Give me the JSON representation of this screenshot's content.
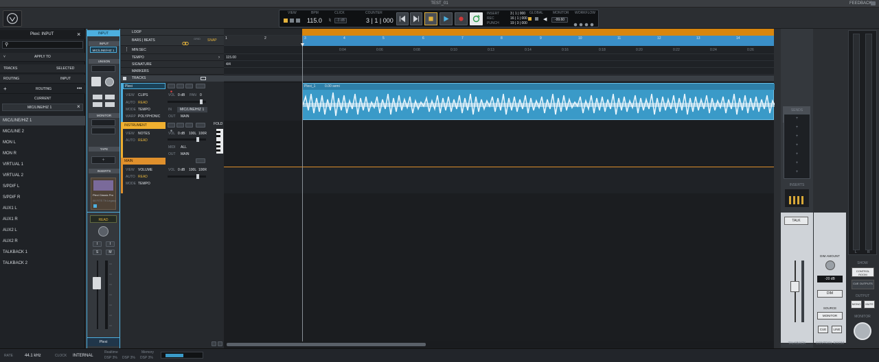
{
  "window": {
    "title": "TEST_01",
    "feedback": "FEEDBACK"
  },
  "transport": {
    "view_label": "VIEW",
    "bpm_label": "BPM",
    "bpm": "115.0",
    "click_label": "CLICK",
    "click_level": "-3 dB",
    "counter_label": "COUNTER",
    "counter": "3 | 1 | 000",
    "insert_label": "INSERT",
    "punch_labels": [
      "REC",
      "PUNCH"
    ],
    "bars_display": [
      "3 | 1 | 000",
      "16 | 1 | 000",
      "19 | 3 | 000"
    ],
    "global_label": "GLOBAL",
    "monitor_label": "MONITOR",
    "monitor_value": "-99.60",
    "workflow_label": "WORKFLOW"
  },
  "input_panel": {
    "title": "Plexi: INPUT",
    "apply_to": "APPLY TO",
    "tracks_label": "TRACKS",
    "tracks_value": "SELECTED",
    "routing_label": "ROUTING",
    "routing_value": "INPUT",
    "routing_header": "ROUTING",
    "current_label": "CURRENT",
    "current_value": "MIC/LINE/HIZ 1",
    "inputs": [
      "MIC/LINE/HIZ 1",
      "MIC/LINE 2",
      "MON L",
      "MON R",
      "VIRTUAL 1",
      "VIRTUAL 2",
      "S/PDIF L",
      "S/PDIF R",
      "AUX1 L",
      "AUX1 R",
      "AUX2 L",
      "AUX2 R",
      "TALKBACK 1",
      "TALKBACK 2"
    ]
  },
  "strip": {
    "input_header": "INPUT",
    "input_label": "INPUT",
    "input_value": "MIC/LINE/HIZ 1",
    "unison_label": "UNISON",
    "monitor_label": "MONITOR",
    "tape_label": "TAPE",
    "inserts_label": "INSERTS",
    "plugin_name": "Plexi Classic Pro",
    "plugin_preset": "08 FITS Th Legacy",
    "automation": "READ",
    "name": "Plexi",
    "btn_i": "I",
    "btn_s": "S",
    "btn_m": "M"
  },
  "ruler": {
    "loop": "LOOP",
    "bars_beats": "BARS | BEATS",
    "grid": "GRID",
    "snap": "SNAP",
    "min_sec": "MIN:SEC",
    "tempo": "TEMPO",
    "tempo_value": "115.00",
    "signature": "SIGNATURE",
    "signature_value": "4/4",
    "markers": "MARKERS",
    "tracks": "TRACKS",
    "bar_numbers": [
      "1",
      "2",
      "3",
      "4",
      "5",
      "6",
      "7",
      "8",
      "9",
      "10",
      "11",
      "12",
      "13",
      "14"
    ],
    "time_labels": [
      "0:04",
      "0:06",
      "0:08",
      "0:10",
      "0:13",
      "0:14",
      "0:16",
      "0:18",
      "0:20",
      "0:22",
      "0:24",
      "0:26",
      "0:28"
    ]
  },
  "tracks": [
    {
      "name": "Plexi",
      "view_label": "VIEW",
      "view": "CLIPS",
      "auto_label": "AUTO",
      "auto": "READ",
      "mode_label": "MODE",
      "mode": "TEMPO",
      "warp_label": "WARP",
      "warp": "POLYPHONIC",
      "vol_label": "VOL",
      "vol": "0 dB",
      "pan_label": "PAN",
      "pan": "0",
      "in_label": "IN",
      "in": "MIC/LINE/HIZ 1",
      "out_label": "OUT",
      "out": "MAIN"
    },
    {
      "name": "INSTRUMENT",
      "view_label": "VIEW",
      "view": "NOTES",
      "auto_label": "AUTO",
      "auto": "READ",
      "vol_label": "VOL",
      "vol": "0 dB",
      "pan": "100L",
      "pan2": "100R",
      "midi_label": "MIDI",
      "midi": "ALL",
      "out_label": "OUT",
      "out": "MAIN",
      "fold": "FOLD"
    },
    {
      "name": "MAIN",
      "view_label": "VIEW",
      "view": "VOLUME",
      "auto_label": "AUTO",
      "auto": "READ",
      "mode_label": "MODE",
      "mode": "TEMPO",
      "vol_label": "VOL",
      "vol": "0 dB",
      "pan": "100L",
      "pan2": "100R"
    }
  ],
  "clip": {
    "name": "Plexi_1",
    "gain": "0.00 semi"
  },
  "monitor": {
    "inserts_label": "INSERTS",
    "sends_label": "SENDS",
    "talk_label": "TALK",
    "dim_amount_label": "DIM AMOUNT",
    "dim_value": "-20 dB",
    "dim_label": "DIM",
    "source_label": "SOURCE",
    "monitor_label": "MONITOR",
    "cue_label": "CUE",
    "line_label": "LINE",
    "mute_label": "MUTE",
    "mono_label": "MONO",
    "show_label": "SHOW",
    "control_room": "CONTROL ROOM",
    "cue_outputs": "CUE OUTPUTS",
    "output_label": "OUTPUT",
    "monitor_knob_label": "MONITOR",
    "talkback": "TALKBACK",
    "control_room_foot": "CONTROL ROOM",
    "meter_l": "L",
    "meter_r": "R"
  },
  "status": {
    "rate_label": "RATE",
    "rate": "44.1 kHz",
    "clock_label": "CLOCK",
    "clock": "INTERNAL",
    "dsp_label": "Realtime",
    "dsp_values": [
      "DSP 3%",
      "DSP 3%",
      "DSP 3%"
    ],
    "buf_label": "Memory"
  },
  "colors": {
    "accent_blue": "#4db0e0",
    "loop_orange": "#d8860e",
    "instrument_yellow": "#f0b030",
    "main_orange": "#e0902c",
    "clip_blue": "#3a9ac8"
  }
}
